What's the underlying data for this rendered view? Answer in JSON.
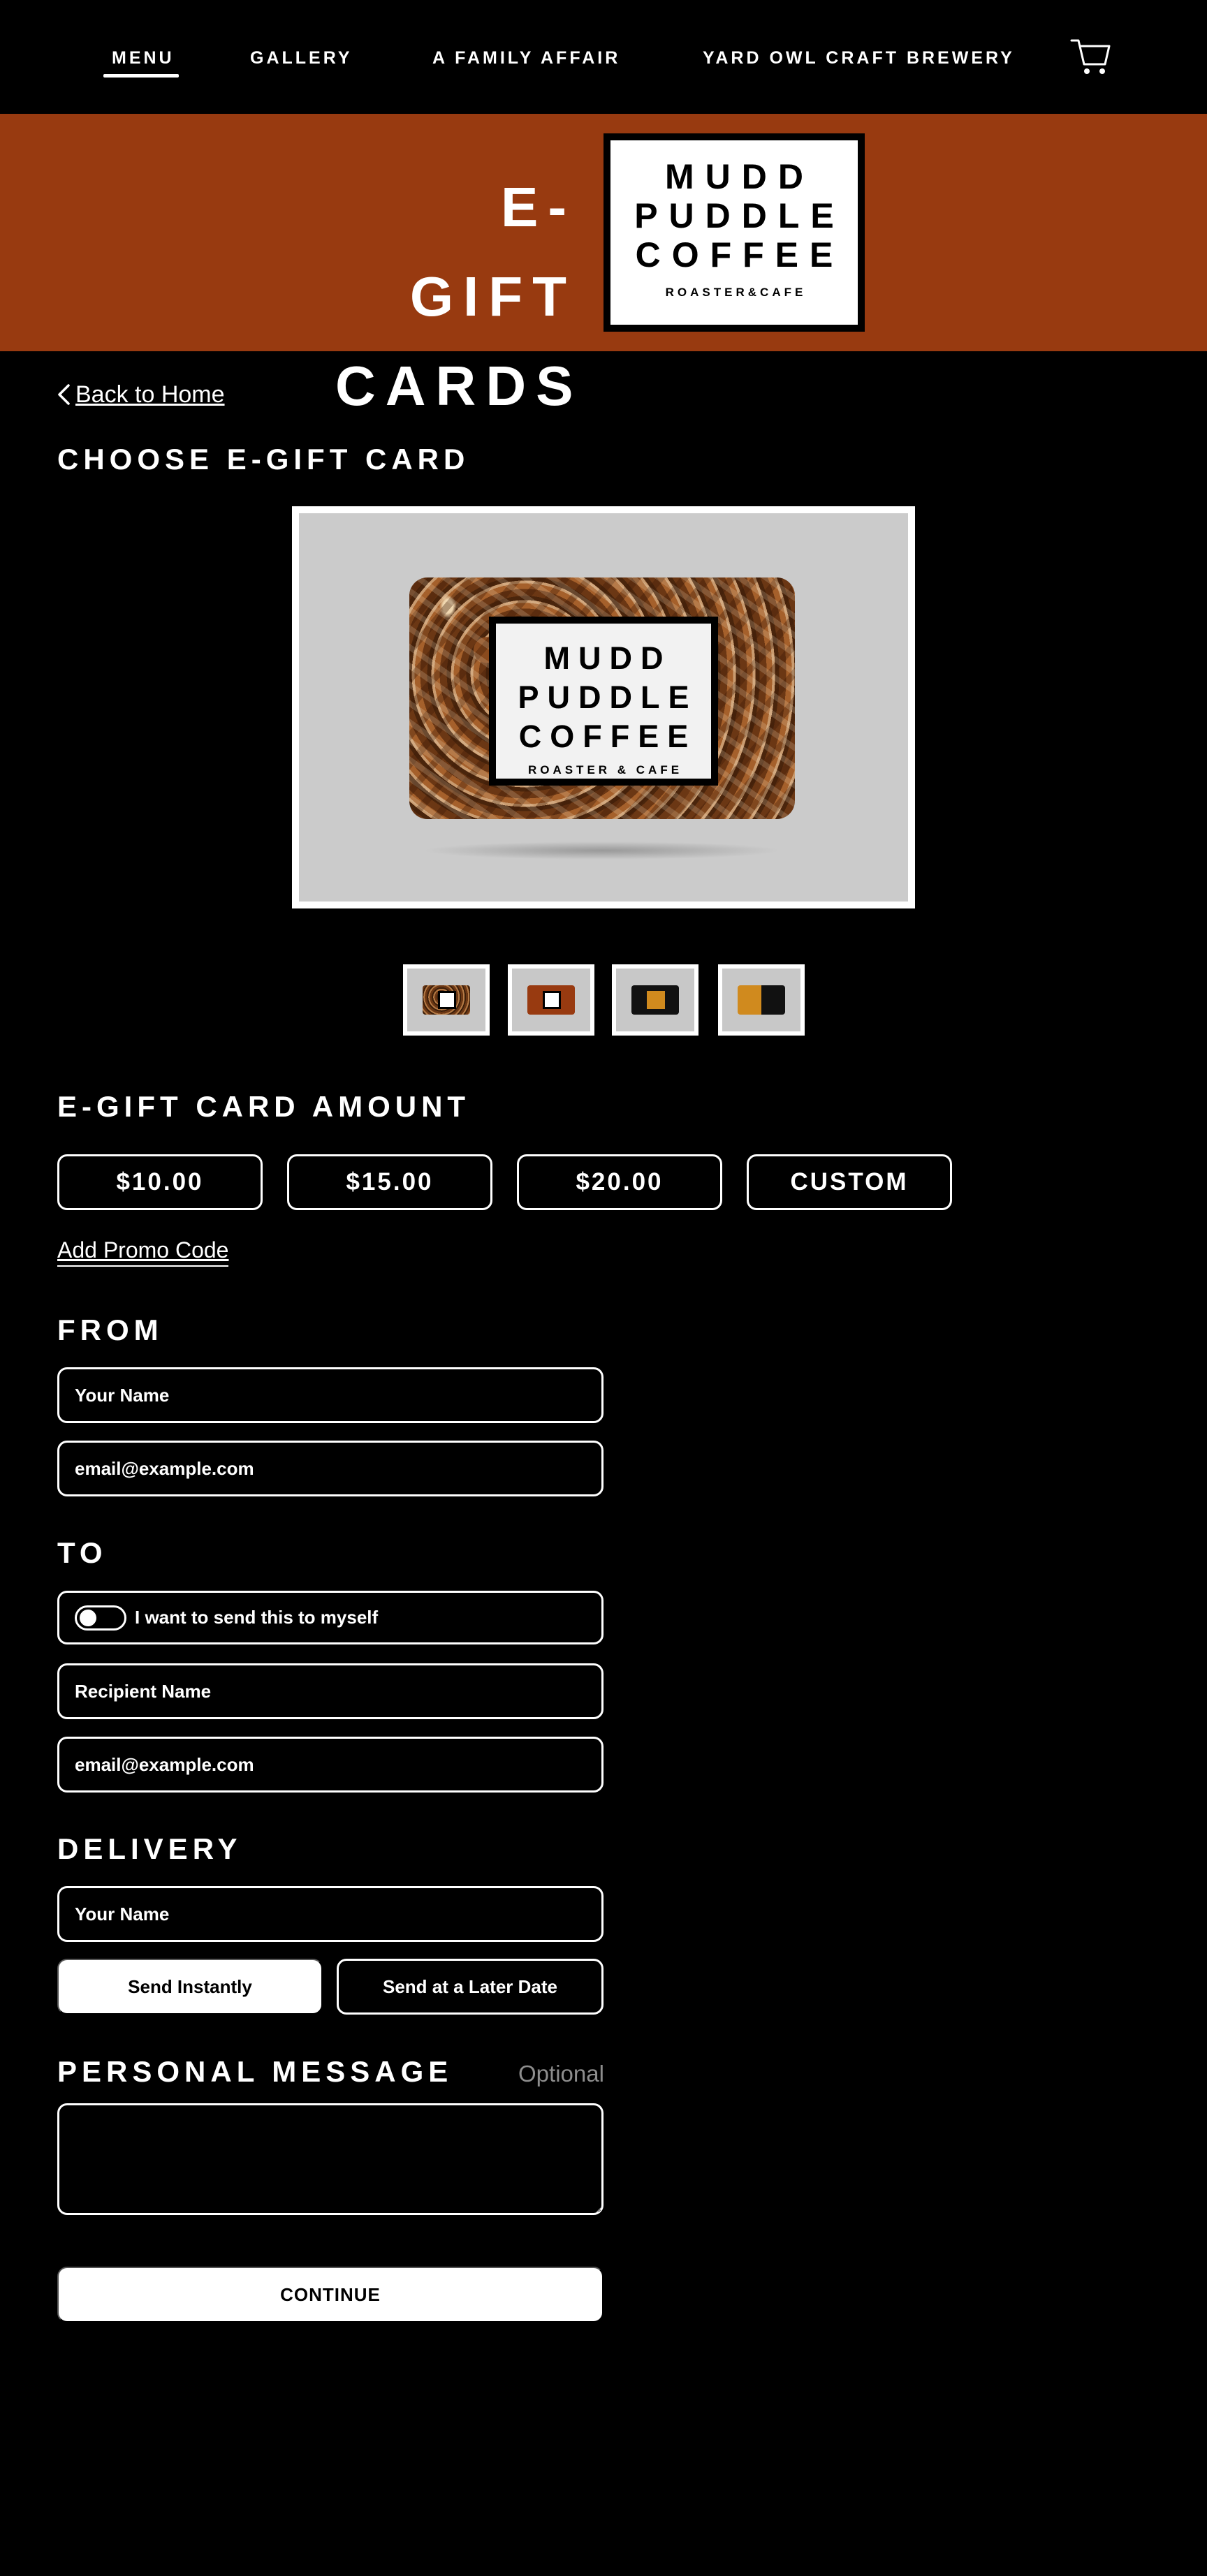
{
  "nav": {
    "items": [
      "MENU",
      "GALLERY",
      "A FAMILY AFFAIR",
      "YARD OWL CRAFT BREWERY"
    ],
    "active": "MENU",
    "cart_icon": "cart-icon"
  },
  "banner": {
    "title_line1": "E-GIFT",
    "title_line2": "CARDS",
    "logo": {
      "line1": "MUDD",
      "line2": "PUDDLE",
      "line3": "COFFEE",
      "sub": "ROASTER&CAFE"
    },
    "background": "#983a10"
  },
  "back_link": "Back to Home",
  "choose": {
    "heading": "CHOOSE E-GIFT CARD",
    "card_logo": {
      "line1": "MUDD",
      "line2": "PUDDLE",
      "line3": "COFFEE",
      "sub": "ROASTER & CAFE"
    },
    "thumbnails": [
      "coffee-beans",
      "brown",
      "black",
      "orange-black"
    ]
  },
  "amount": {
    "heading": "E-GIFT CARD AMOUNT",
    "options": [
      "$10.00",
      "$15.00",
      "$20.00",
      "CUSTOM"
    ],
    "promo": "Add Promo Code"
  },
  "from": {
    "heading": "FROM",
    "name_placeholder": "Your Name",
    "email_placeholder": "email@example.com"
  },
  "to": {
    "heading": "TO",
    "self_label": "I want to send this to myself",
    "self_checked": false,
    "name_placeholder": "Recipient Name",
    "email_placeholder": "email@example.com"
  },
  "delivery": {
    "heading": "DELIVERY",
    "name_placeholder": "Your Name",
    "instant": "Send Instantly",
    "later": "Send at a Later Date"
  },
  "message": {
    "heading": "PERSONAL MESSAGE",
    "optional": "Optional"
  },
  "continue": "CONTINUE"
}
